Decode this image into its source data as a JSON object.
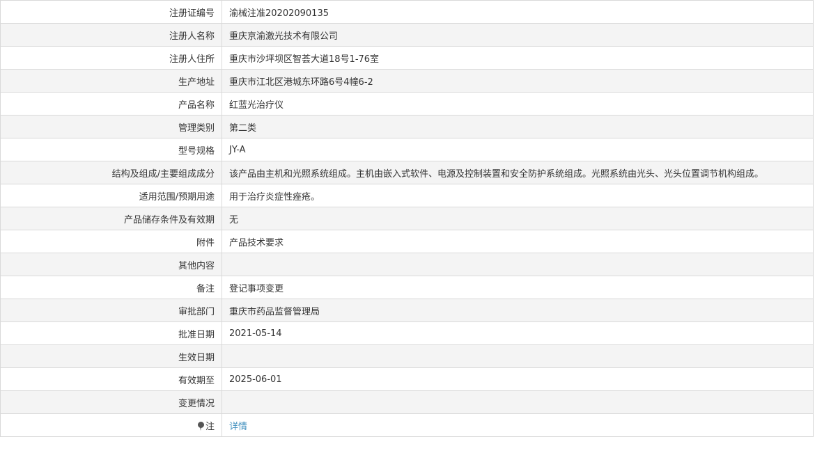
{
  "rows": [
    {
      "label": "注册证编号",
      "value": "渝械注准20202090135"
    },
    {
      "label": "注册人名称",
      "value": "重庆京渝激光技术有限公司"
    },
    {
      "label": "注册人住所",
      "value": "重庆市沙坪坝区智荟大道18号1-76室"
    },
    {
      "label": "生产地址",
      "value": "重庆市江北区港城东环路6号4幢6-2"
    },
    {
      "label": "产品名称",
      "value": "红蓝光治疗仪"
    },
    {
      "label": "管理类别",
      "value": "第二类"
    },
    {
      "label": "型号规格",
      "value": "JY-A"
    },
    {
      "label": "结构及组成/主要组成成分",
      "value": "该产品由主机和光照系统组成。主机由嵌入式软件、电源及控制装置和安全防护系统组成。光照系统由光头、光头位置调节机构组成。"
    },
    {
      "label": "适用范围/预期用途",
      "value": "用于治疗炎症性痤疮。"
    },
    {
      "label": "产品储存条件及有效期",
      "value": "无"
    },
    {
      "label": "附件",
      "value": "产品技术要求"
    },
    {
      "label": "其他内容",
      "value": ""
    },
    {
      "label": "备注",
      "value": "登记事项变更"
    },
    {
      "label": "审批部门",
      "value": "重庆市药品监督管理局"
    },
    {
      "label": "批准日期",
      "value": "2021-05-14"
    },
    {
      "label": "生效日期",
      "value": ""
    },
    {
      "label": "有效期至",
      "value": "2025-06-01"
    },
    {
      "label": "变更情况",
      "value": ""
    }
  ],
  "note": {
    "icon": "pin-icon",
    "label": "注",
    "link_text": "详情",
    "link_color": "#3c8dbc"
  }
}
